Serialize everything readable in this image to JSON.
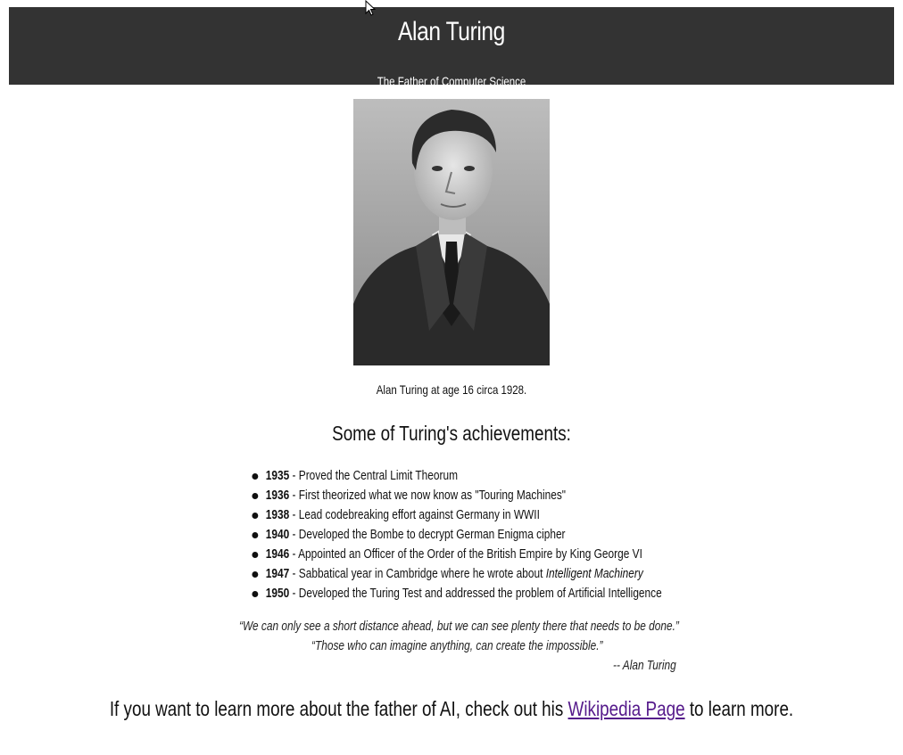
{
  "header": {
    "title": "Alan Turing",
    "subtitle": "The Father of Computer Science"
  },
  "image": {
    "caption": "Alan Turing at age 16 circa 1928."
  },
  "achievements": {
    "heading": "Some of Turing's achievements:",
    "items": [
      {
        "year": "1935",
        "text": " - Proved the Central Limit Theorum",
        "italic": ""
      },
      {
        "year": "1936",
        "text": " - First theorized what we now know as \"Touring Machines\"",
        "italic": ""
      },
      {
        "year": "1938",
        "text": " - Lead codebreaking effort against Germany in WWII",
        "italic": ""
      },
      {
        "year": "1940",
        "text": " - Developed the Bombe to decrypt German Enigma cipher",
        "italic": ""
      },
      {
        "year": "1946",
        "text": " - Appointed an Officer of the Order of the British Empire by King George VI",
        "italic": ""
      },
      {
        "year": "1947",
        "text": " - Sabbatical year in Cambridge where he wrote about ",
        "italic": "Intelligent Machinery"
      },
      {
        "year": "1950",
        "text": " - Developed the Turing Test and addressed the problem of Artificial Intelligence",
        "italic": ""
      }
    ]
  },
  "quotes": {
    "quote1": "“We can only see a short distance ahead, but we can see plenty there that needs to be done.”",
    "quote2": "“Those who can imagine anything, can create the impossible.”",
    "attribution": "-- Alan Turing"
  },
  "footer": {
    "text_before": "If you want to learn more about the father of AI, check out his ",
    "link_label": "Wikipedia Page",
    "text_after": " to learn more."
  }
}
